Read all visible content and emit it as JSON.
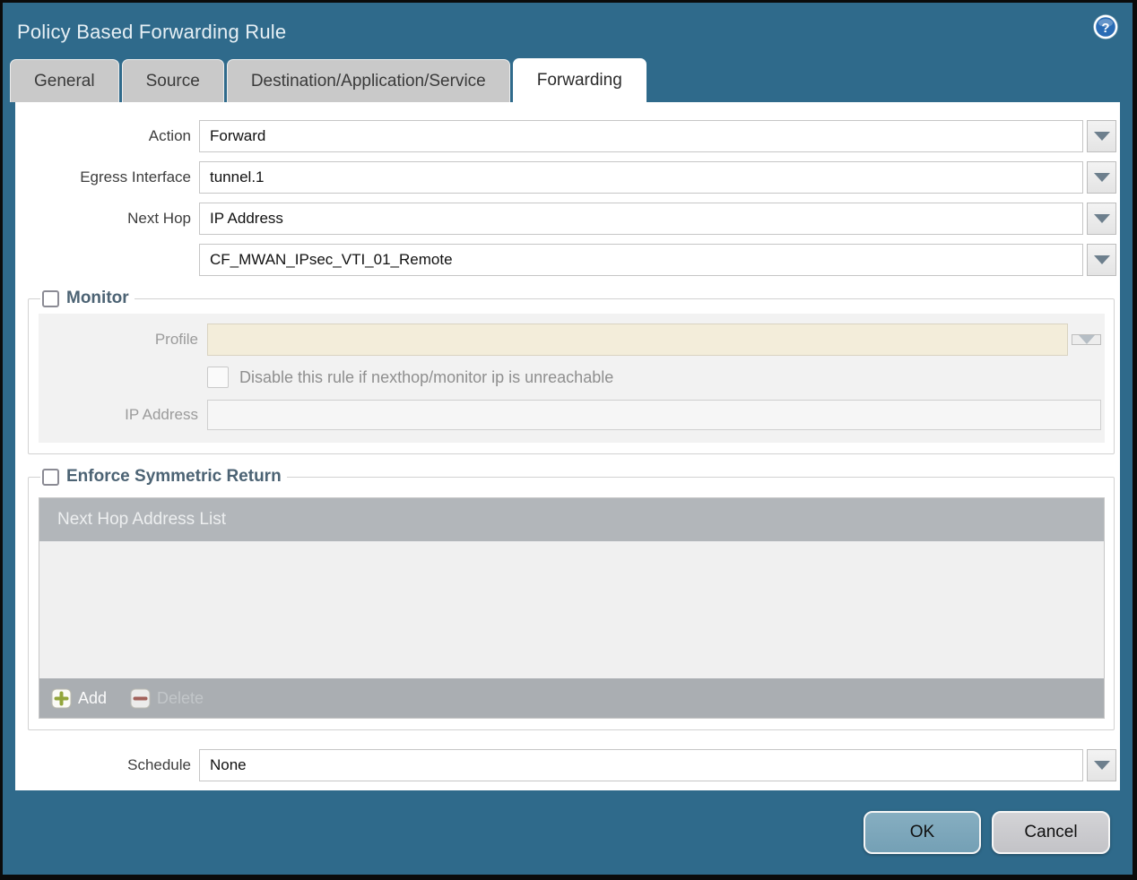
{
  "dialog": {
    "title": "Policy Based Forwarding Rule"
  },
  "tabs": {
    "items": [
      {
        "label": "General",
        "active": false
      },
      {
        "label": "Source",
        "active": false
      },
      {
        "label": "Destination/Application/Service",
        "active": false
      },
      {
        "label": "Forwarding",
        "active": true
      }
    ]
  },
  "form": {
    "action": {
      "label": "Action",
      "value": "Forward"
    },
    "egress_interface": {
      "label": "Egress Interface",
      "value": "tunnel.1"
    },
    "next_hop": {
      "label": "Next Hop",
      "value": "IP Address"
    },
    "next_hop_address": {
      "value": "CF_MWAN_IPsec_VTI_01_Remote"
    },
    "schedule": {
      "label": "Schedule",
      "value": "None"
    }
  },
  "monitor": {
    "legend": "Monitor",
    "checked": false,
    "profile_label": "Profile",
    "profile_value": "",
    "disable_rule_label": "Disable this rule if nexthop/monitor ip is unreachable",
    "disable_rule_checked": false,
    "ip_address_label": "IP Address",
    "ip_address_value": ""
  },
  "symmetric_return": {
    "legend": "Enforce Symmetric Return",
    "checked": false,
    "table_header": "Next Hop Address List",
    "rows": [],
    "add_label": "Add",
    "delete_label": "Delete",
    "delete_enabled": false
  },
  "footer": {
    "ok_label": "OK",
    "cancel_label": "Cancel"
  },
  "icons": {
    "help": "question-mark-circle",
    "add": "plus-badge",
    "delete": "minus-badge",
    "dropdown": "chevron-down-triangle"
  },
  "colors": {
    "dialog_teal": "#2f6a8b",
    "tab_inactive": "#c9c9c9",
    "tab_active": "#ffffff",
    "legend_text": "#4c6374",
    "disabled_field_beige": "#f3edda",
    "table_header_gray": "#b2b6ba",
    "table_footer_gray": "#aaaeb2",
    "ok_button_blue": "#7aa5ba",
    "cancel_button_gray": "#cbcbcf",
    "add_icon_green": "#92a53b",
    "delete_icon_red": "#a2625b",
    "help_icon_blue": "#2a6cb5"
  }
}
